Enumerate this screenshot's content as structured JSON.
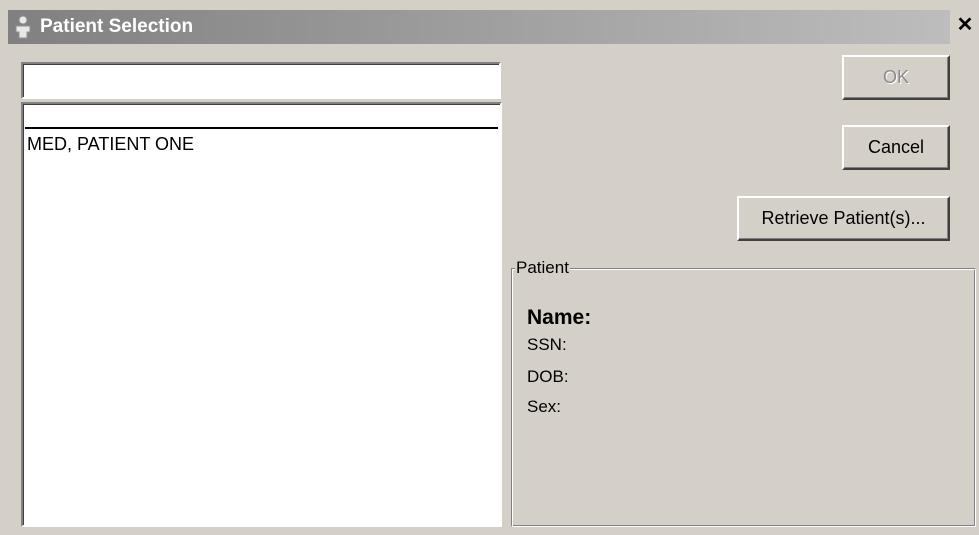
{
  "window": {
    "title": "Patient Selection",
    "close_glyph": "✕",
    "icon": "person-icon"
  },
  "search": {
    "value": "",
    "placeholder": ""
  },
  "patient_list": {
    "items": [
      "MED, PATIENT ONE"
    ]
  },
  "buttons": {
    "ok_label": "OK",
    "ok_enabled": false,
    "cancel_label": "Cancel",
    "retrieve_label": "Retrieve Patient(s)..."
  },
  "patient_info": {
    "group_label": "Patient",
    "name_label": "Name:",
    "ssn_label": "SSN:",
    "dob_label": "DOB:",
    "sex_label": "Sex:"
  },
  "colors": {
    "window_bg": "#d4d0c8",
    "title_gradient_start": "#808080",
    "title_gradient_end": "#bdbdbd",
    "disabled_text": "#8a8a8a"
  }
}
